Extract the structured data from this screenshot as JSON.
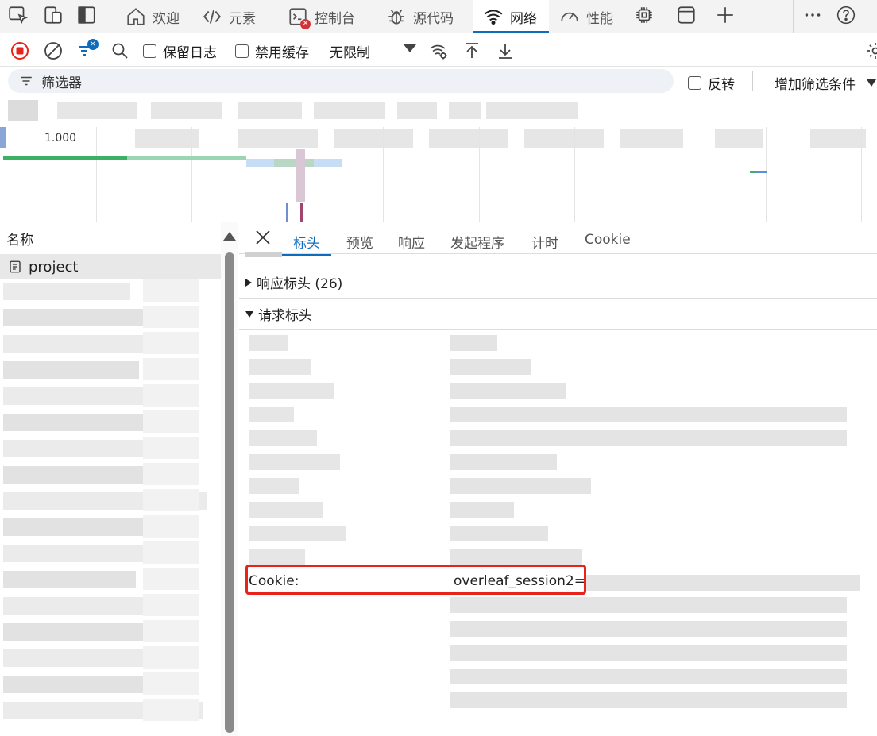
{
  "tabs": [
    {
      "label": "欢迎"
    },
    {
      "label": "元素"
    },
    {
      "label": "控制台"
    },
    {
      "label": "源代码"
    },
    {
      "label": "网络"
    },
    {
      "label": "性能"
    }
  ],
  "toolbar": {
    "preserve_log": "保留日志",
    "disable_cache": "禁用缓存",
    "throttling": "无限制"
  },
  "filter": {
    "placeholder": "筛选器",
    "invert": "反转",
    "add_filter": "增加筛选条件"
  },
  "overview": {
    "tick_label": "1.000"
  },
  "requests": {
    "header": "名称",
    "selected": "project"
  },
  "details": {
    "tabs": [
      "标头",
      "预览",
      "响应",
      "发起程序",
      "计时",
      "Cookie"
    ],
    "active_tab": "标头",
    "response_headers": "响应标头 (26)",
    "request_headers": "请求标头",
    "cookie_name": "Cookie:",
    "cookie_value": "overleaf_session2="
  },
  "colors": {
    "accent": "#0f6cbd",
    "record": "#e8231b",
    "highlight_border": "#e8231b"
  }
}
